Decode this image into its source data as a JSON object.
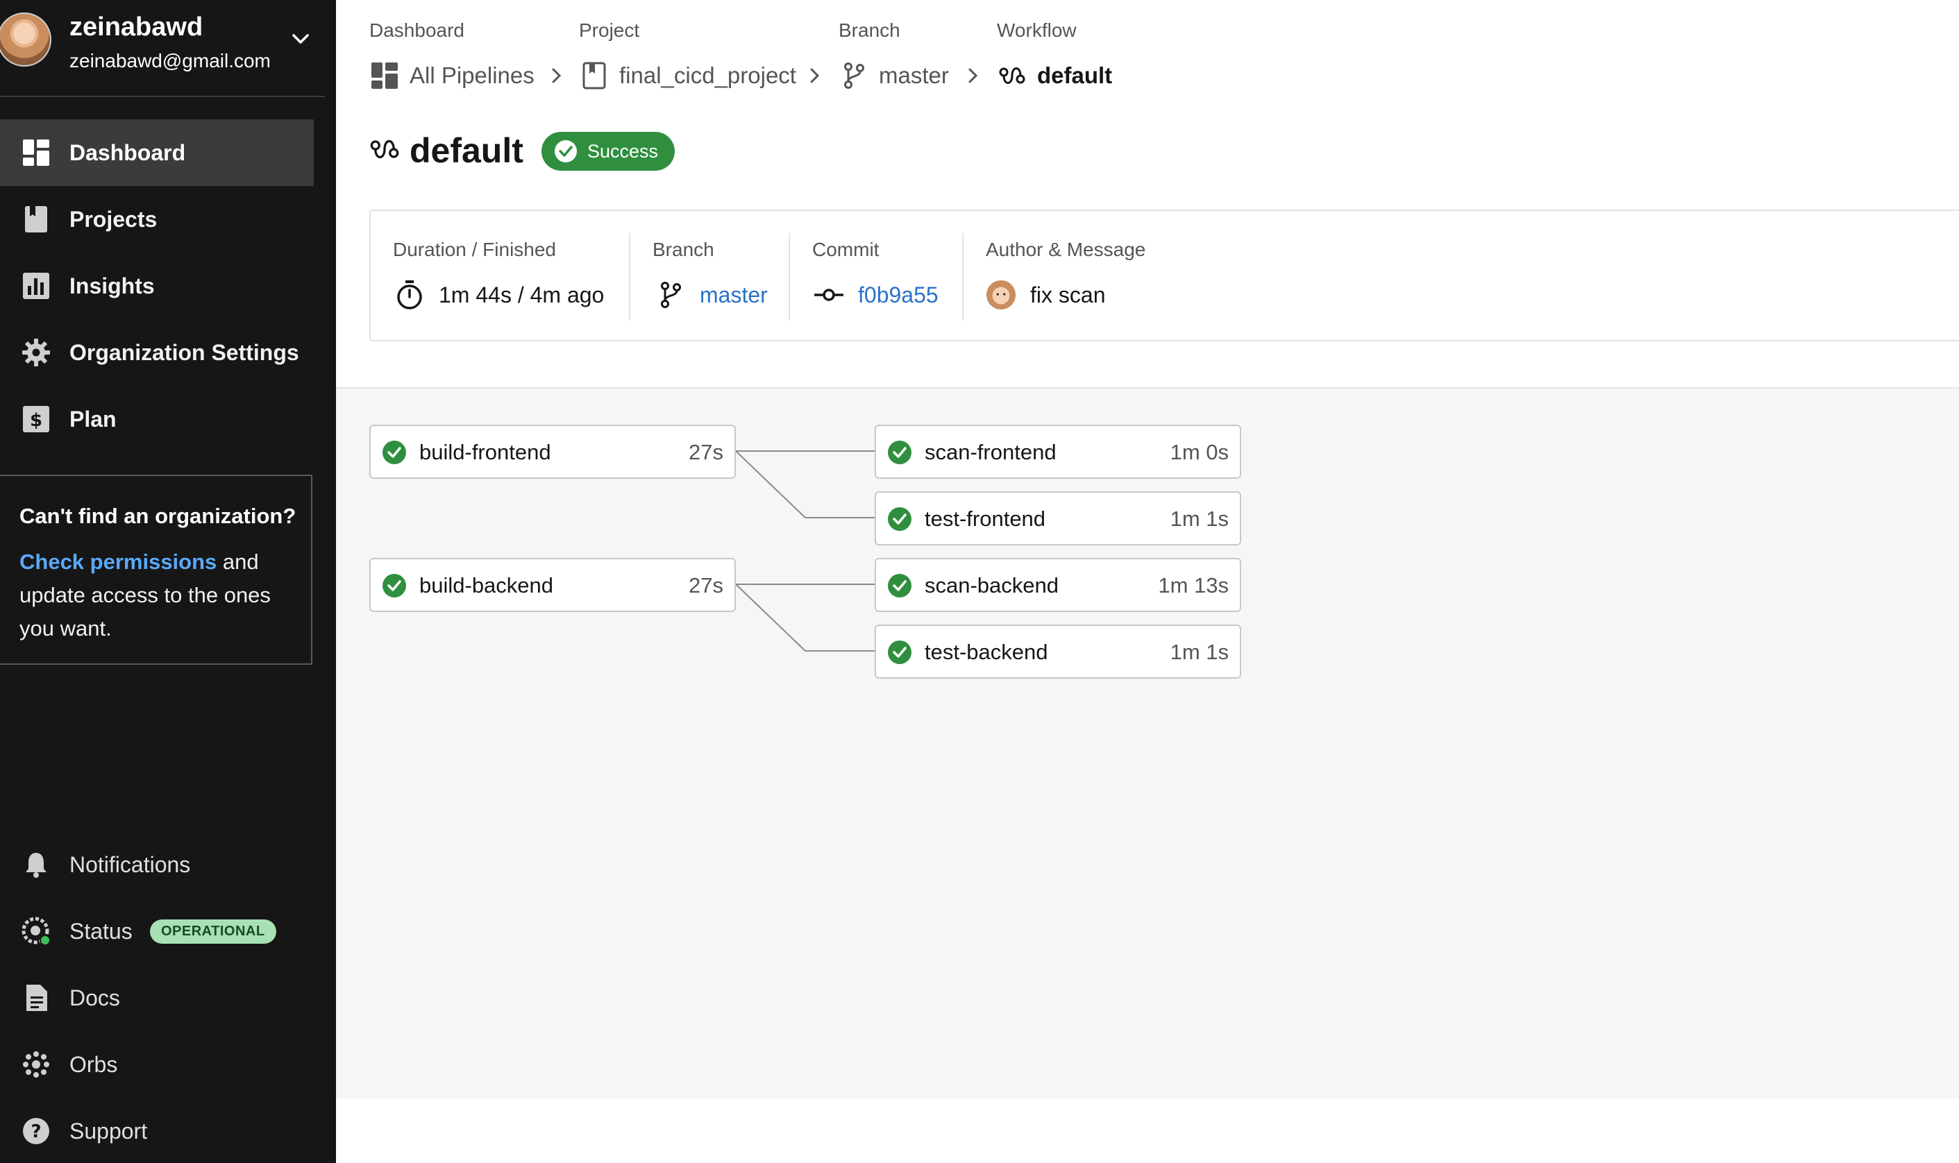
{
  "user": {
    "name": "zeinabawd",
    "email": "zeinabawd@gmail.com"
  },
  "nav": [
    {
      "label": "Dashboard",
      "icon": "dashboard-icon",
      "active": true
    },
    {
      "label": "Projects",
      "icon": "projects-icon"
    },
    {
      "label": "Insights",
      "icon": "insights-icon"
    },
    {
      "label": "Organization Settings",
      "icon": "gear-icon"
    },
    {
      "label": "Plan",
      "icon": "dollar-icon"
    }
  ],
  "org_box": {
    "title": "Can't find an organization?",
    "link": "Check permissions",
    "text": " and update access to the ones you want."
  },
  "bottom_nav": [
    {
      "label": "Notifications",
      "icon": "bell-icon"
    },
    {
      "label": "Status",
      "icon": "status-icon",
      "badge": "OPERATIONAL"
    },
    {
      "label": "Docs",
      "icon": "docs-icon"
    },
    {
      "label": "Orbs",
      "icon": "orbs-icon"
    },
    {
      "label": "Support",
      "icon": "help-icon"
    }
  ],
  "breadcrumb": {
    "labels": [
      "Dashboard",
      "Project",
      "Branch",
      "Workflow"
    ],
    "items": [
      "All Pipelines",
      "final_cicd_project",
      "master",
      "default"
    ]
  },
  "workflow": {
    "title": "default",
    "status": "Success"
  },
  "summary": {
    "duration_label": "Duration / Finished",
    "duration_value": "1m 44s / 4m ago",
    "branch_label": "Branch",
    "branch_value": "master",
    "commit_label": "Commit",
    "commit_value": "f0b9a55",
    "author_label": "Author & Message",
    "author_message": "fix scan"
  },
  "jobs": [
    {
      "name": "build-frontend",
      "duration": "27s",
      "status": "success"
    },
    {
      "name": "scan-frontend",
      "duration": "1m 0s",
      "status": "success"
    },
    {
      "name": "test-frontend",
      "duration": "1m 1s",
      "status": "success"
    },
    {
      "name": "build-backend",
      "duration": "27s",
      "status": "success"
    },
    {
      "name": "scan-backend",
      "duration": "1m 13s",
      "status": "success"
    },
    {
      "name": "test-backend",
      "duration": "1m 1s",
      "status": "success"
    }
  ],
  "colors": {
    "success": "#2f8f3f",
    "link": "#2a72c9",
    "sidebar": "#161616",
    "operational": "#a8e1b3"
  }
}
